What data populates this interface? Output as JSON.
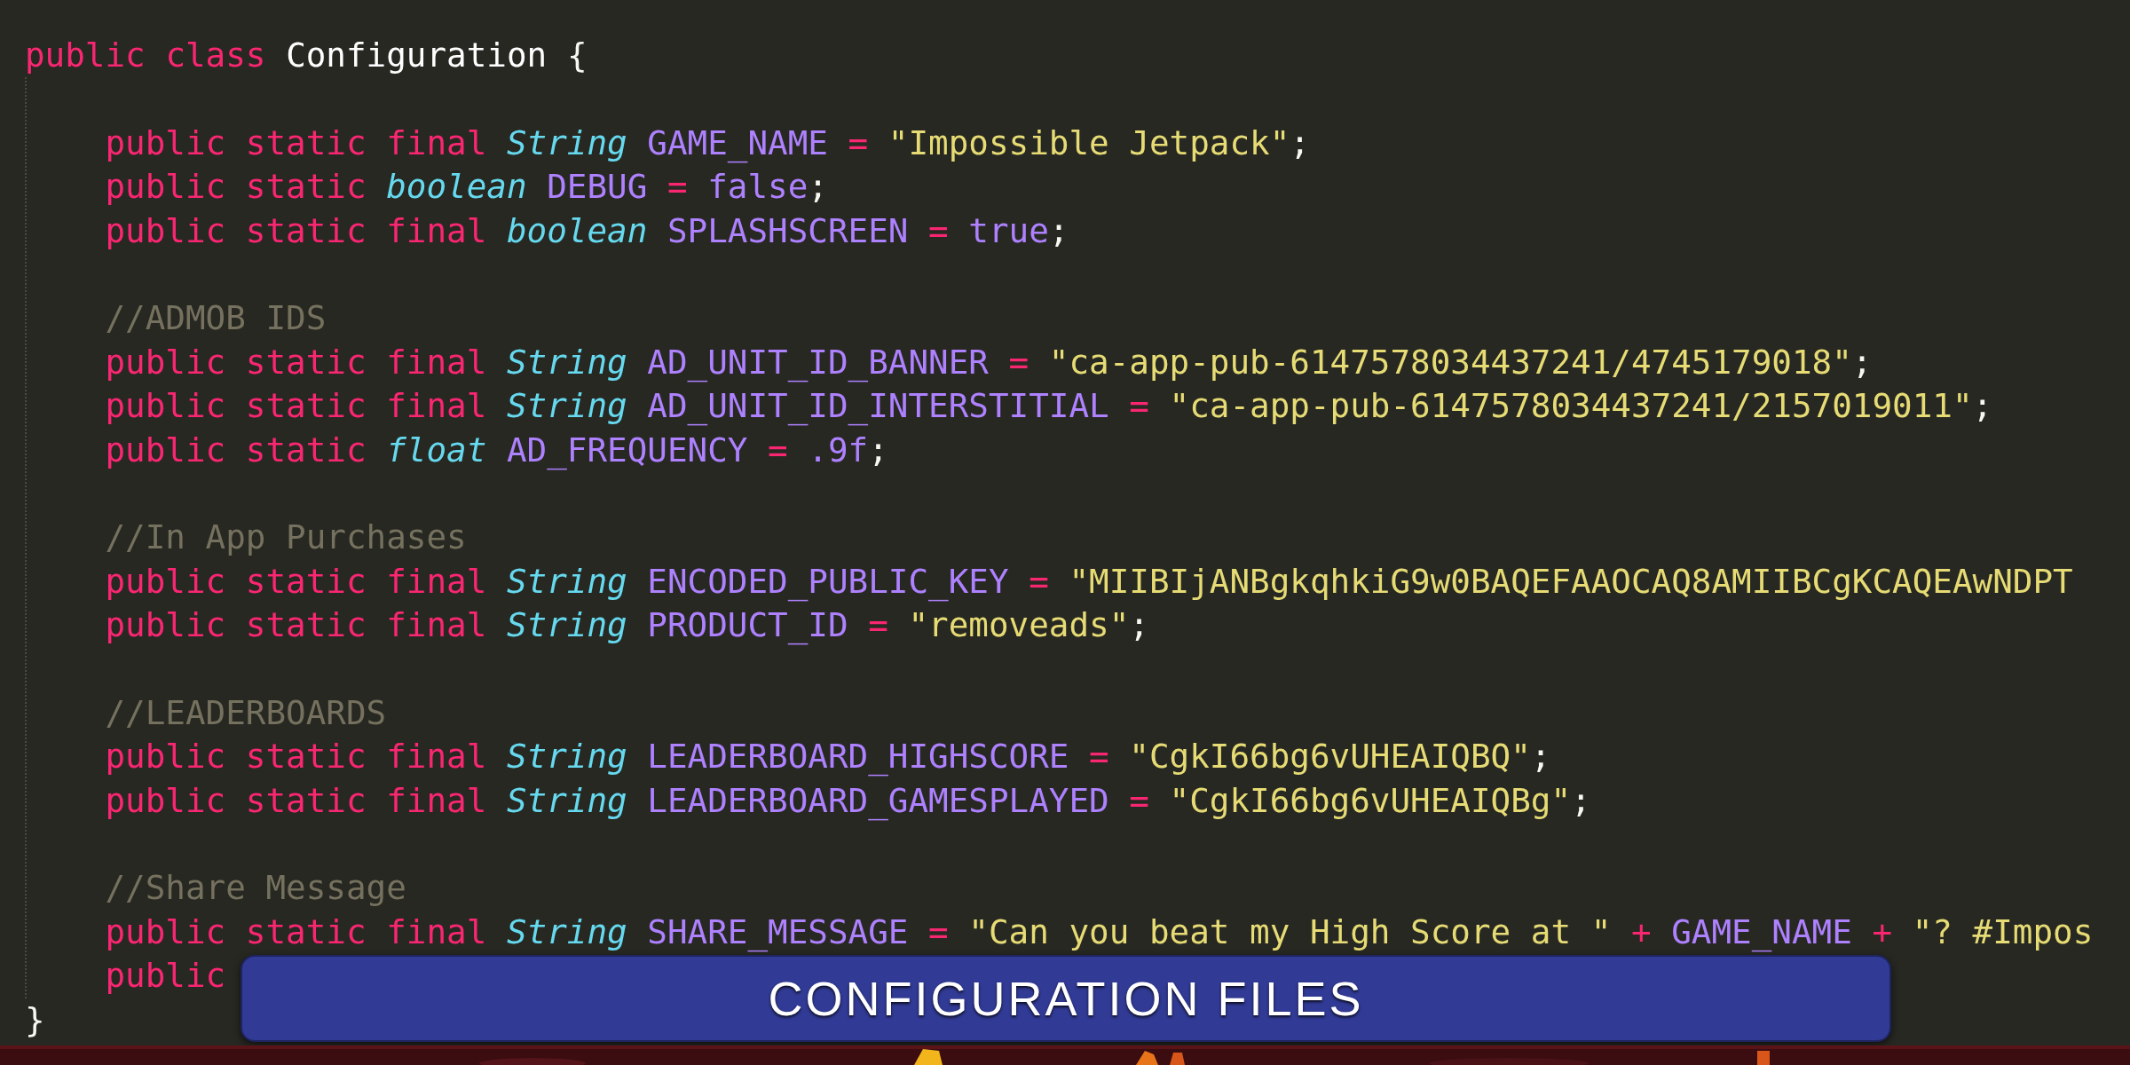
{
  "editor": {
    "class_line": [
      {
        "kind": "keyword",
        "text": "public"
      },
      {
        "kind": "keyword",
        "text": "class"
      },
      {
        "kind": "classname",
        "text": "Configuration"
      },
      {
        "kind": "brace",
        "text": "{"
      }
    ],
    "body": [
      {
        "kind": "blank"
      },
      {
        "kind": "code",
        "tokens": [
          {
            "kind": "keyword",
            "text": "public"
          },
          {
            "kind": "keyword",
            "text": "static"
          },
          {
            "kind": "keyword",
            "text": "final"
          },
          {
            "kind": "type",
            "text": "String"
          },
          {
            "kind": "constant",
            "text": "GAME_NAME"
          },
          {
            "kind": "operator",
            "text": "="
          },
          {
            "kind": "string",
            "text": "\"Impossible Jetpack\""
          },
          {
            "kind": "punct",
            "text": ";"
          }
        ]
      },
      {
        "kind": "code",
        "tokens": [
          {
            "kind": "keyword",
            "text": "public"
          },
          {
            "kind": "keyword",
            "text": "static"
          },
          {
            "kind": "type",
            "text": "boolean"
          },
          {
            "kind": "constant",
            "text": "DEBUG"
          },
          {
            "kind": "operator",
            "text": "="
          },
          {
            "kind": "constant",
            "text": "false"
          },
          {
            "kind": "punct",
            "text": ";"
          }
        ]
      },
      {
        "kind": "code",
        "tokens": [
          {
            "kind": "keyword",
            "text": "public"
          },
          {
            "kind": "keyword",
            "text": "static"
          },
          {
            "kind": "keyword",
            "text": "final"
          },
          {
            "kind": "type",
            "text": "boolean"
          },
          {
            "kind": "constant",
            "text": "SPLASHSCREEN"
          },
          {
            "kind": "operator",
            "text": "="
          },
          {
            "kind": "constant",
            "text": "true"
          },
          {
            "kind": "punct",
            "text": ";"
          }
        ]
      },
      {
        "kind": "blank"
      },
      {
        "kind": "code",
        "tokens": [
          {
            "kind": "comment",
            "text": "//ADMOB IDS"
          }
        ]
      },
      {
        "kind": "code",
        "tokens": [
          {
            "kind": "keyword",
            "text": "public"
          },
          {
            "kind": "keyword",
            "text": "static"
          },
          {
            "kind": "keyword",
            "text": "final"
          },
          {
            "kind": "type",
            "text": "String"
          },
          {
            "kind": "constant",
            "text": "AD_UNIT_ID_BANNER"
          },
          {
            "kind": "operator",
            "text": "="
          },
          {
            "kind": "string",
            "text": "\"ca-app-pub-6147578034437241/4745179018\""
          },
          {
            "kind": "punct",
            "text": ";"
          }
        ]
      },
      {
        "kind": "code",
        "tokens": [
          {
            "kind": "keyword",
            "text": "public"
          },
          {
            "kind": "keyword",
            "text": "static"
          },
          {
            "kind": "keyword",
            "text": "final"
          },
          {
            "kind": "type",
            "text": "String"
          },
          {
            "kind": "constant",
            "text": "AD_UNIT_ID_INTERSTITIAL"
          },
          {
            "kind": "operator",
            "text": "="
          },
          {
            "kind": "string",
            "text": "\"ca-app-pub-6147578034437241/2157019011\""
          },
          {
            "kind": "punct",
            "text": ";"
          }
        ]
      },
      {
        "kind": "code",
        "tokens": [
          {
            "kind": "keyword",
            "text": "public"
          },
          {
            "kind": "keyword",
            "text": "static"
          },
          {
            "kind": "type",
            "text": "float"
          },
          {
            "kind": "constant",
            "text": "AD_FREQUENCY"
          },
          {
            "kind": "operator",
            "text": "="
          },
          {
            "kind": "constant",
            "text": ".9f"
          },
          {
            "kind": "punct",
            "text": ";"
          }
        ]
      },
      {
        "kind": "blank"
      },
      {
        "kind": "code",
        "tokens": [
          {
            "kind": "comment",
            "text": "//In App Purchases"
          }
        ]
      },
      {
        "kind": "code",
        "tokens": [
          {
            "kind": "keyword",
            "text": "public"
          },
          {
            "kind": "keyword",
            "text": "static"
          },
          {
            "kind": "keyword",
            "text": "final"
          },
          {
            "kind": "type",
            "text": "String"
          },
          {
            "kind": "constant",
            "text": "ENCODED_PUBLIC_KEY"
          },
          {
            "kind": "operator",
            "text": "="
          },
          {
            "kind": "string",
            "text": "\"MIIBIjANBgkqhkiG9w0BAQEFAAOCAQ8AMIIBCgKCAQEAwNDPT"
          }
        ]
      },
      {
        "kind": "code",
        "tokens": [
          {
            "kind": "keyword",
            "text": "public"
          },
          {
            "kind": "keyword",
            "text": "static"
          },
          {
            "kind": "keyword",
            "text": "final"
          },
          {
            "kind": "type",
            "text": "String"
          },
          {
            "kind": "constant",
            "text": "PRODUCT_ID"
          },
          {
            "kind": "operator",
            "text": "="
          },
          {
            "kind": "string",
            "text": "\"removeads\""
          },
          {
            "kind": "punct",
            "text": ";"
          }
        ]
      },
      {
        "kind": "blank"
      },
      {
        "kind": "code",
        "tokens": [
          {
            "kind": "comment",
            "text": "//LEADERBOARDS"
          }
        ]
      },
      {
        "kind": "code",
        "tokens": [
          {
            "kind": "keyword",
            "text": "public"
          },
          {
            "kind": "keyword",
            "text": "static"
          },
          {
            "kind": "keyword",
            "text": "final"
          },
          {
            "kind": "type",
            "text": "String"
          },
          {
            "kind": "constant",
            "text": "LEADERBOARD_HIGHSCORE"
          },
          {
            "kind": "operator",
            "text": "="
          },
          {
            "kind": "string",
            "text": "\"CgkI66bg6vUHEAIQBQ\""
          },
          {
            "kind": "punct",
            "text": ";"
          }
        ]
      },
      {
        "kind": "code",
        "tokens": [
          {
            "kind": "keyword",
            "text": "public"
          },
          {
            "kind": "keyword",
            "text": "static"
          },
          {
            "kind": "keyword",
            "text": "final"
          },
          {
            "kind": "type",
            "text": "String"
          },
          {
            "kind": "constant",
            "text": "LEADERBOARD_GAMESPLAYED"
          },
          {
            "kind": "operator",
            "text": "="
          },
          {
            "kind": "string",
            "text": "\"CgkI66bg6vUHEAIQBg\""
          },
          {
            "kind": "punct",
            "text": ";"
          }
        ]
      },
      {
        "kind": "blank"
      },
      {
        "kind": "code",
        "tokens": [
          {
            "kind": "comment",
            "text": "//Share Message"
          }
        ]
      },
      {
        "kind": "code",
        "tokens": [
          {
            "kind": "keyword",
            "text": "public"
          },
          {
            "kind": "keyword",
            "text": "static"
          },
          {
            "kind": "keyword",
            "text": "final"
          },
          {
            "kind": "type",
            "text": "String"
          },
          {
            "kind": "constant",
            "text": "SHARE_MESSAGE"
          },
          {
            "kind": "operator",
            "text": "="
          },
          {
            "kind": "string",
            "text": "\"Can you beat my High Score at \""
          },
          {
            "kind": "operator",
            "text": "+"
          },
          {
            "kind": "constant",
            "text": "GAME_NAME"
          },
          {
            "kind": "operator",
            "text": "+"
          },
          {
            "kind": "string",
            "text": "\"? #Impos"
          }
        ]
      },
      {
        "kind": "code",
        "tokens": [
          {
            "kind": "keyword",
            "text": "public"
          }
        ]
      }
    ],
    "closing": "}"
  },
  "banner": {
    "title": "CONFIGURATION FILES"
  }
}
